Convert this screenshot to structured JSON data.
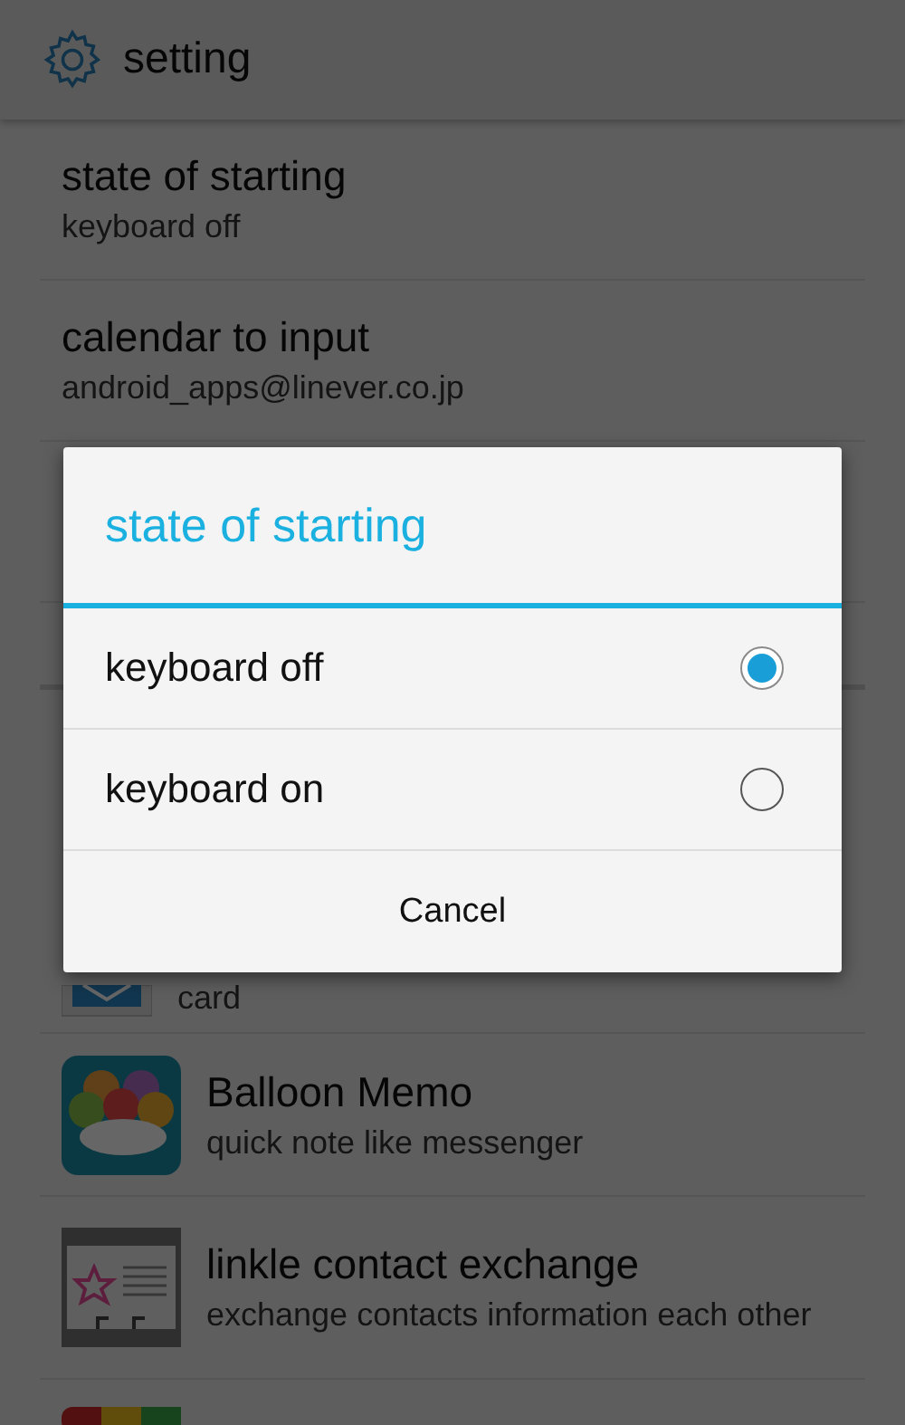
{
  "app_bar": {
    "title": "setting"
  },
  "settings": [
    {
      "title": "state of starting",
      "summary": "keyboard off"
    },
    {
      "title": "calendar to input",
      "summary": "android_apps@linever.co.jp"
    }
  ],
  "apps": [
    {
      "kind": "card",
      "summary": "card"
    },
    {
      "kind": "balloon",
      "title": "Balloon Memo",
      "summary": "quick note like messenger"
    },
    {
      "kind": "exchange",
      "title": "linkle contact exchange",
      "summary": "exchange contacts information each other"
    },
    {
      "kind": "rainbow"
    }
  ],
  "dialog": {
    "title": "state of starting",
    "options": [
      {
        "label": "keyboard off",
        "selected": true
      },
      {
        "label": "keyboard on",
        "selected": false
      }
    ],
    "button": "Cancel"
  }
}
